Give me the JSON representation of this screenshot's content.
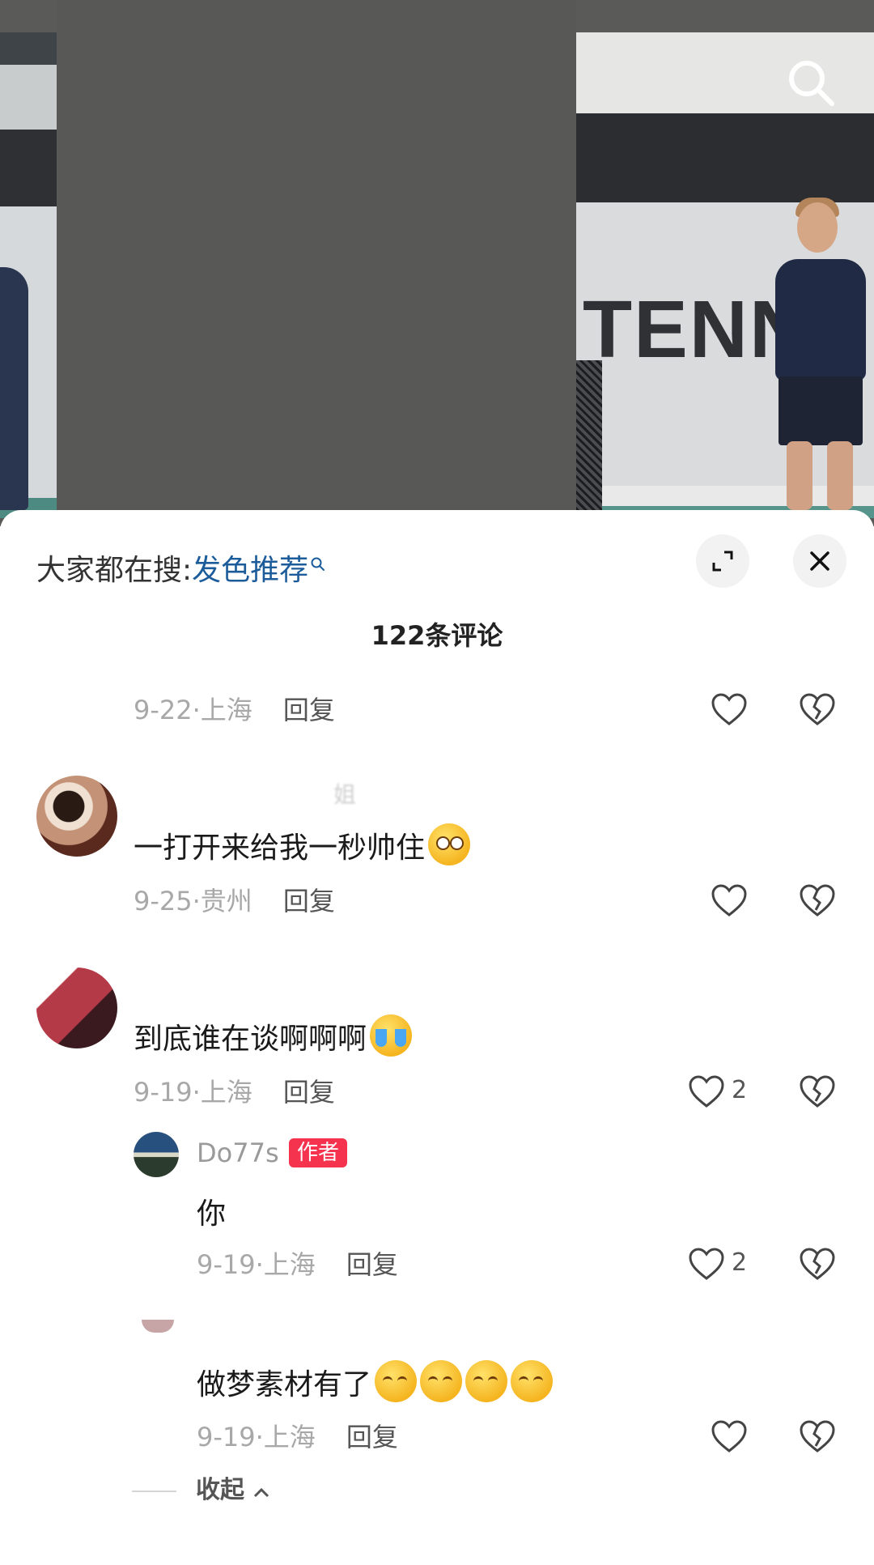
{
  "video": {
    "banner_text": "TENN",
    "search_icon": "search-icon"
  },
  "sheet": {
    "suggest_prefix": "大家都在搜:",
    "suggest_keyword": "发色推荐",
    "expand_icon": "expand-icon",
    "close_icon": "close-icon",
    "comment_count": "122条评论",
    "collapse_label": "收起"
  },
  "comments": [
    {
      "text": "",
      "date": "9-22",
      "location": "上海",
      "reply": "回复",
      "likes": ""
    },
    {
      "user": "姐",
      "text": "一打开来给我一秒帅住",
      "emoji": "flushed-emoji",
      "date": "9-25",
      "location": "贵州",
      "reply": "回复",
      "likes": ""
    },
    {
      "text": "到底谁在谈啊啊啊",
      "emoji": "crying-emoji",
      "date": "9-19",
      "location": "上海",
      "reply": "回复",
      "likes": "2"
    }
  ],
  "replies": [
    {
      "user": "Do77s",
      "badge": "作者",
      "text": "你",
      "date": "9-19",
      "location": "上海",
      "reply": "回复",
      "likes": "2"
    },
    {
      "text": "做梦素材有了",
      "emoji": "relieved-emoji",
      "date": "9-19",
      "location": "上海",
      "reply": "回复",
      "likes": ""
    }
  ],
  "colors": {
    "keyword": "#1c5c9a",
    "badge": "#f5334f",
    "meta": "#a8a8a8"
  }
}
